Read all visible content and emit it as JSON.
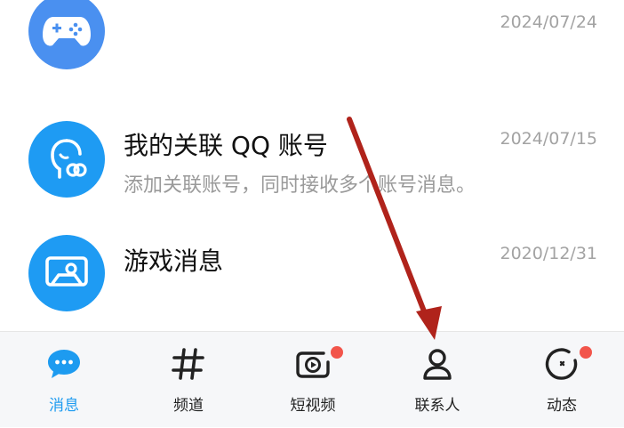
{
  "conversations": [
    {
      "title": "",
      "subtitle": "",
      "time": "2024/07/24",
      "icon": "gamepad-icon",
      "color": "#4a90f0"
    },
    {
      "title": "我的关联 QQ 账号",
      "subtitle": "添加关联账号，同时接收多个账号消息。",
      "time": "2024/07/15",
      "icon": "linked-account-icon",
      "color": "#1e9bf3"
    },
    {
      "title": "游戏消息",
      "subtitle": "",
      "time": "2020/12/31",
      "icon": "game-screen-icon",
      "color": "#1e9bf3"
    }
  ],
  "tabbar": {
    "tabs": [
      {
        "label": "消息",
        "icon": "message-bubble-icon",
        "active": true,
        "badge": false
      },
      {
        "label": "频道",
        "icon": "hashtag-icon",
        "active": false,
        "badge": false
      },
      {
        "label": "短视频",
        "icon": "short-video-icon",
        "active": false,
        "badge": true
      },
      {
        "label": "联系人",
        "icon": "contacts-icon",
        "active": false,
        "badge": false
      },
      {
        "label": "动态",
        "icon": "moments-icon",
        "active": false,
        "badge": true
      }
    ]
  },
  "colors": {
    "accent": "#1d9bf0",
    "badge": "#f2554b",
    "annotation_arrow": "#b0231b"
  }
}
